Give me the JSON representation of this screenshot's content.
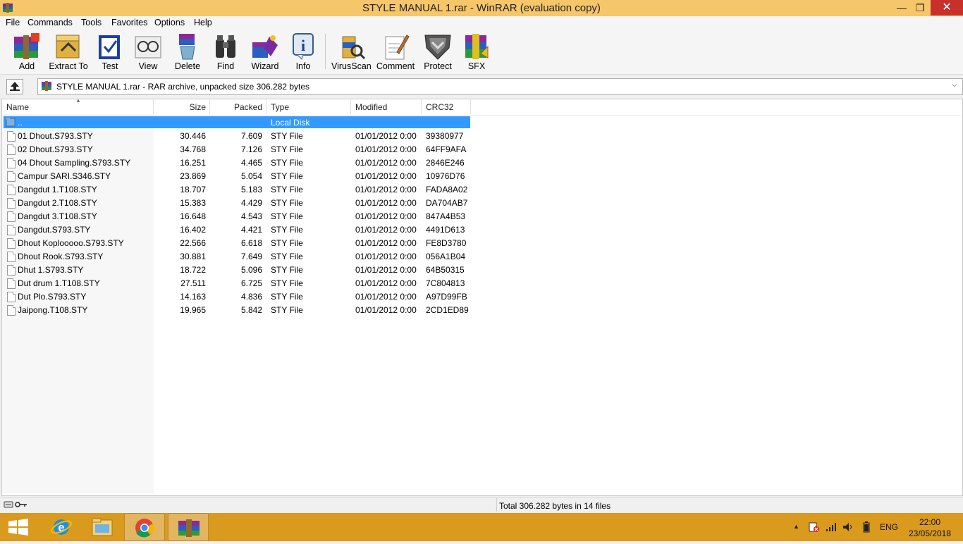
{
  "window": {
    "title": "STYLE MANUAL 1.rar - WinRAR (evaluation copy)",
    "controls": {
      "minimize": "—",
      "maximize": "❐",
      "close": "✕"
    }
  },
  "menu": [
    "File",
    "Commands",
    "Tools",
    "Favorites",
    "Options",
    "Help"
  ],
  "toolbar": [
    {
      "label": "Add",
      "icon": "add-archive-icon"
    },
    {
      "label": "Extract To",
      "icon": "extract-icon"
    },
    {
      "label": "Test",
      "icon": "test-icon"
    },
    {
      "label": "View",
      "icon": "view-icon"
    },
    {
      "label": "Delete",
      "icon": "delete-icon"
    },
    {
      "label": "Find",
      "icon": "find-icon"
    },
    {
      "label": "Wizard",
      "icon": "wizard-icon"
    },
    {
      "label": "Info",
      "icon": "info-icon"
    },
    {
      "label": "VirusScan",
      "icon": "virusscan-icon"
    },
    {
      "label": "Comment",
      "icon": "comment-icon"
    },
    {
      "label": "Protect",
      "icon": "protect-icon"
    },
    {
      "label": "SFX",
      "icon": "sfx-icon"
    }
  ],
  "address": {
    "text": "STYLE MANUAL 1.rar - RAR archive, unpacked size 306.282 bytes"
  },
  "columns": {
    "name": "Name",
    "size": "Size",
    "packed": "Packed",
    "type": "Type",
    "modified": "Modified",
    "crc": "CRC32"
  },
  "parent_row": {
    "name": "..",
    "type": "Local Disk"
  },
  "files": [
    {
      "name": "01 Dhout.S793.STY",
      "size": "30.446",
      "packed": "7.609",
      "type": "STY File",
      "modified": "01/01/2012 0:00",
      "crc": "39380977"
    },
    {
      "name": "02 Dhout.S793.STY",
      "size": "34.768",
      "packed": "7.126",
      "type": "STY File",
      "modified": "01/01/2012 0:00",
      "crc": "64FF9AFA"
    },
    {
      "name": "04 Dhout Sampling.S793.STY",
      "size": "16.251",
      "packed": "4.465",
      "type": "STY File",
      "modified": "01/01/2012 0:00",
      "crc": "2846E246"
    },
    {
      "name": "Campur SARI.S346.STY",
      "size": "23.869",
      "packed": "5.054",
      "type": "STY File",
      "modified": "01/01/2012 0:00",
      "crc": "10976D76"
    },
    {
      "name": "Dangdut 1.T108.STY",
      "size": "18.707",
      "packed": "5.183",
      "type": "STY File",
      "modified": "01/01/2012 0:00",
      "crc": "FADA8A02"
    },
    {
      "name": "Dangdut 2.T108.STY",
      "size": "15.383",
      "packed": "4.429",
      "type": "STY File",
      "modified": "01/01/2012 0:00",
      "crc": "DA704AB7"
    },
    {
      "name": "Dangdut 3.T108.STY",
      "size": "16.648",
      "packed": "4.543",
      "type": "STY File",
      "modified": "01/01/2012 0:00",
      "crc": "847A4B53"
    },
    {
      "name": "Dangdut.S793.STY",
      "size": "16.402",
      "packed": "4.421",
      "type": "STY File",
      "modified": "01/01/2012 0:00",
      "crc": "4491D613"
    },
    {
      "name": "Dhout Kopl​ooooo.S793.STY",
      "size": "22.566",
      "packed": "6.618",
      "type": "STY File",
      "modified": "01/01/2012 0:00",
      "crc": "FE8D3780"
    },
    {
      "name": "Dhout Rook.S793.STY",
      "size": "30.881",
      "packed": "7.649",
      "type": "STY File",
      "modified": "01/01/2012 0:00",
      "crc": "056A1B04"
    },
    {
      "name": "Dhut 1.S793.STY",
      "size": "18.722",
      "packed": "5.096",
      "type": "STY File",
      "modified": "01/01/2012 0:00",
      "crc": "64B50315"
    },
    {
      "name": "Dut drum 1.T108.STY",
      "size": "27.511",
      "packed": "6.725",
      "type": "STY File",
      "modified": "01/01/2012 0:00",
      "crc": "7C804813"
    },
    {
      "name": "Dut Plo.S793.STY",
      "size": "14.163",
      "packed": "4.836",
      "type": "STY File",
      "modified": "01/01/2012 0:00",
      "crc": "A97D99FB"
    },
    {
      "name": "Jaipong.T108.STY",
      "size": "19.965",
      "packed": "5.842",
      "type": "STY File",
      "modified": "01/01/2012 0:00",
      "crc": "2CD1ED89"
    }
  ],
  "status": {
    "text": "Total 306.282 bytes in 14 files"
  },
  "taskbar": {
    "apps": [
      "start-icon",
      "internet-explorer-icon",
      "file-explorer-icon",
      "chrome-icon",
      "winrar-icon"
    ],
    "tray": {
      "language": "ENG",
      "time": "22:00",
      "date": "23/05/2018"
    }
  },
  "colors": {
    "titlebar": "#f6c66a",
    "selection": "#3399ff",
    "taskbar": "#d99a1e",
    "close": "#c7302b"
  }
}
